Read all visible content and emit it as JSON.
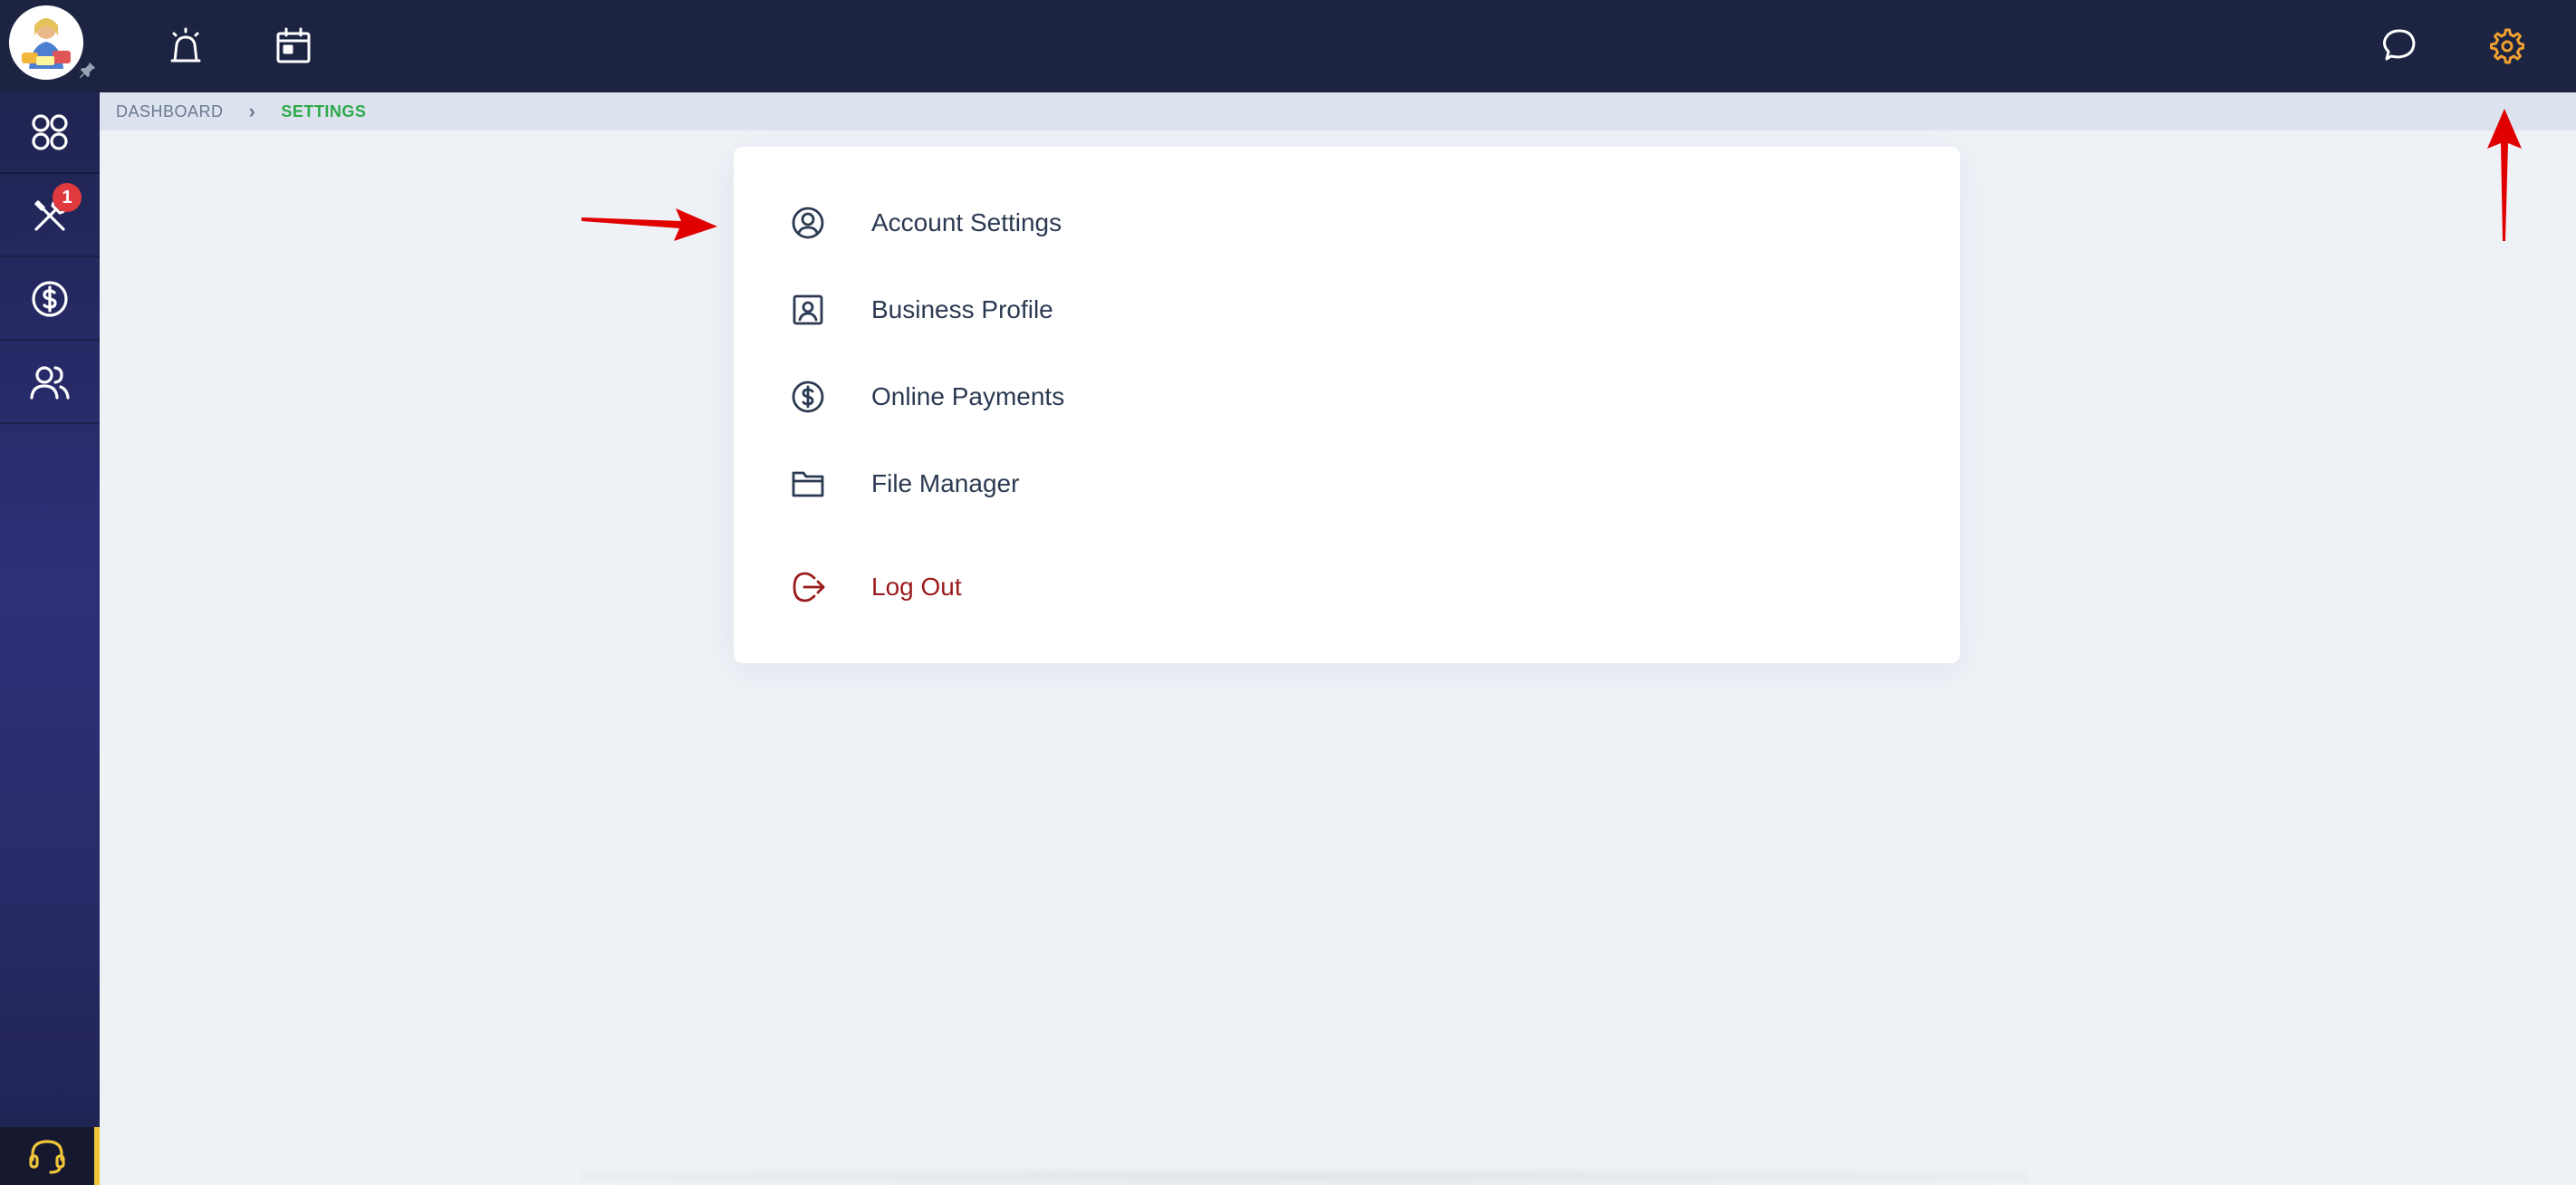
{
  "topbar": {
    "logo_icon": "company-logo-avatar",
    "pin_icon": "pin-icon",
    "alert_icon": "alarm-bell-icon",
    "calendar_icon": "calendar-icon",
    "chat_icon": "chat-bubble-icon",
    "settings_icon": "gear-icon"
  },
  "sidebar": {
    "items": [
      {
        "icon": "dashboard-grid-icon"
      },
      {
        "icon": "tools-icon",
        "badge": "1"
      },
      {
        "icon": "dollar-circle-icon"
      },
      {
        "icon": "users-icon"
      }
    ],
    "support_icon": "headset-icon"
  },
  "breadcrumb": {
    "parent": "DASHBOARD",
    "current": "SETTINGS"
  },
  "settings_menu": {
    "items": [
      {
        "label": "Account Settings",
        "icon": "user-circle-icon"
      },
      {
        "label": "Business Profile",
        "icon": "profile-card-icon"
      },
      {
        "label": "Online Payments",
        "icon": "dollar-circle-icon"
      },
      {
        "label": "File Manager",
        "icon": "folder-icon"
      },
      {
        "label": "Log Out",
        "icon": "logout-icon"
      }
    ]
  },
  "colors": {
    "topbar_bg": "#1c2442",
    "accent_orange": "#f0a030",
    "breadcrumb_active": "#2eaa4a",
    "logout_red": "#9b1b1b",
    "annotation_red": "#e00000",
    "badge_red": "#e03a3e"
  }
}
